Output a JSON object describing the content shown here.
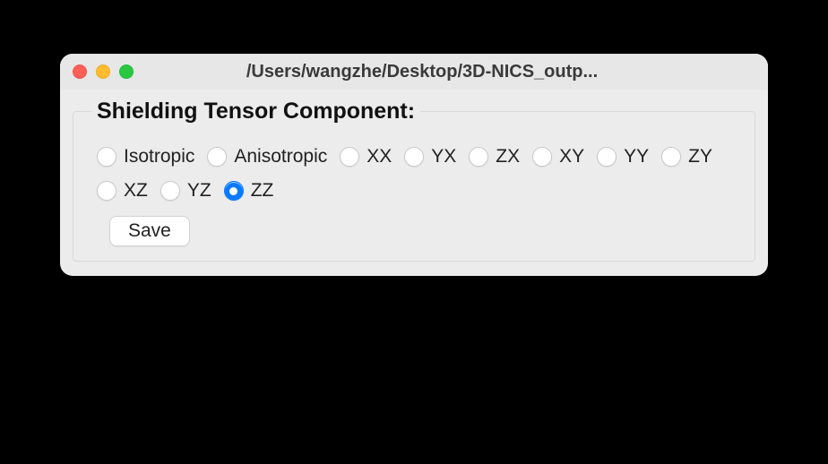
{
  "window": {
    "title": "/Users/wangzhe/Desktop/3D-NICS_outp..."
  },
  "fieldset": {
    "legend": "Shielding Tensor Component:"
  },
  "radios": [
    {
      "label": "Isotropic",
      "selected": false
    },
    {
      "label": "Anisotropic",
      "selected": false
    },
    {
      "label": "XX",
      "selected": false
    },
    {
      "label": "YX",
      "selected": false
    },
    {
      "label": "ZX",
      "selected": false
    },
    {
      "label": "XY",
      "selected": false
    },
    {
      "label": "YY",
      "selected": false
    },
    {
      "label": "ZY",
      "selected": false
    },
    {
      "label": "XZ",
      "selected": false
    },
    {
      "label": "YZ",
      "selected": false
    },
    {
      "label": "ZZ",
      "selected": true
    }
  ],
  "buttons": {
    "save": "Save"
  }
}
